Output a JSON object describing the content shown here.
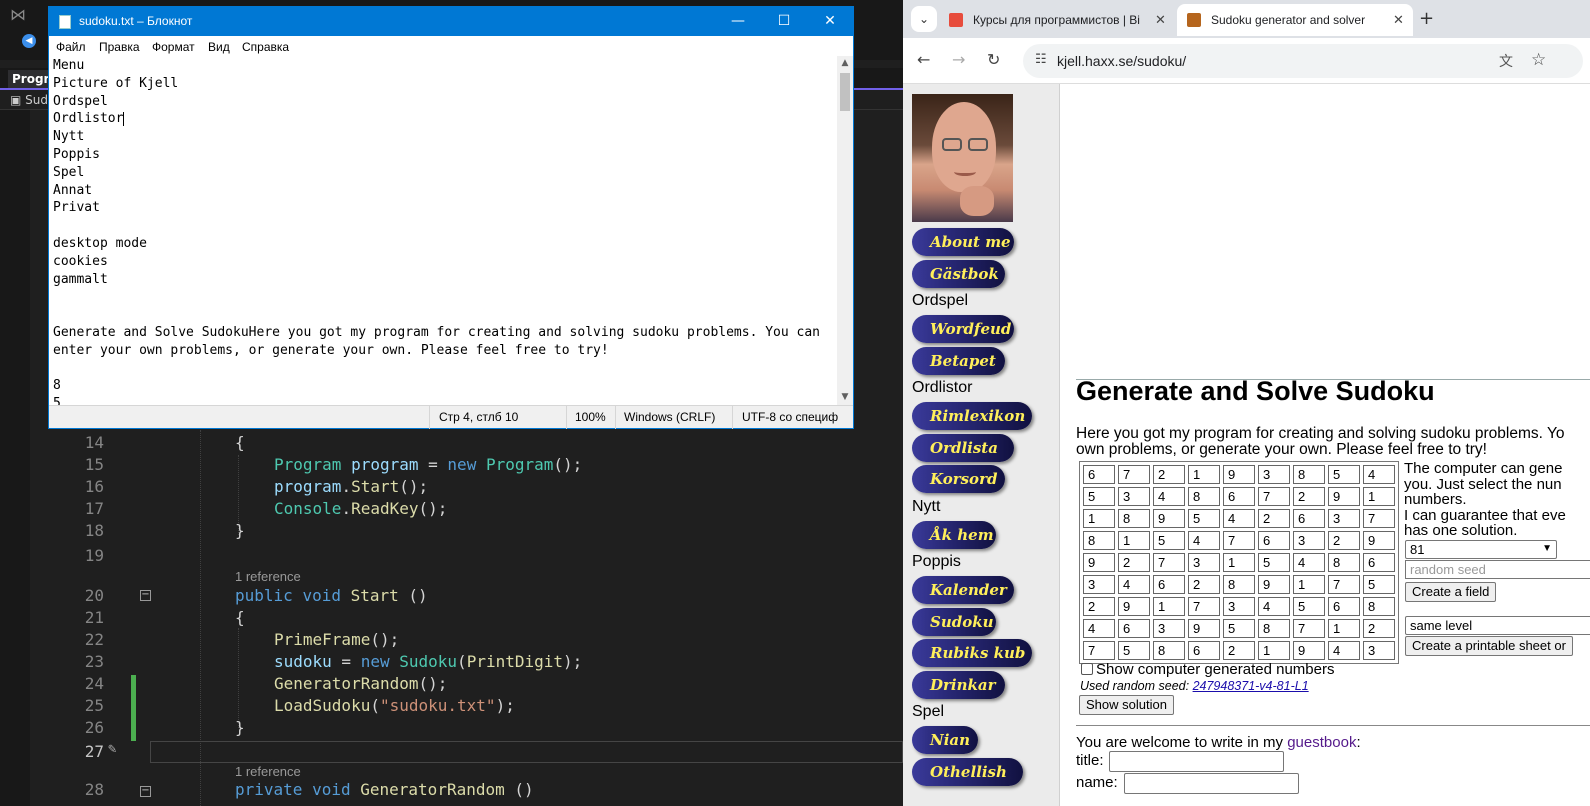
{
  "notepad": {
    "title": "sudoku.txt – Блокнот",
    "menu": [
      "Файл",
      "Правка",
      "Формат",
      "Вид",
      "Справка"
    ],
    "lines": [
      "Menu",
      "Picture of Kjell",
      "Ordspel",
      "Ordlistor",
      "Nytt",
      "Poppis",
      "Spel",
      "Annat",
      "Privat",
      "",
      "desktop mode",
      "cookies",
      "gammalt",
      "",
      "",
      "Generate and Solve SudokuHere you got my program for creating and solving sudoku problems. You can",
      "enter your own problems, or generate your own. Please feel free to try!",
      "",
      "8",
      "5"
    ],
    "status": {
      "position": "Стр 4, стлб 10",
      "zoom": "100%",
      "line_ending": "Windows (CRLF)",
      "encoding": "UTF-8 со специф"
    }
  },
  "vs": {
    "tab_label": "Progra",
    "file_label": "Sud",
    "codelens": "1 reference",
    "lines": [
      {
        "num": "14",
        "code": "{"
      },
      {
        "num": "15",
        "code": "Program program = new Program();"
      },
      {
        "num": "16",
        "code": "program.Start();"
      },
      {
        "num": "17",
        "code": "Console.ReadKey();"
      },
      {
        "num": "18",
        "code": "}"
      },
      {
        "num": "19",
        "code": ""
      },
      {
        "num": "20",
        "code": "public void Start ()"
      },
      {
        "num": "21",
        "code": "{"
      },
      {
        "num": "22",
        "code": "PrimeFrame();"
      },
      {
        "num": "23",
        "code": "sudoku = new Sudoku(PrintDigit);"
      },
      {
        "num": "24",
        "code": "GeneratorRandom();"
      },
      {
        "num": "25",
        "code": "LoadSudoku(\"sudoku.txt\");"
      },
      {
        "num": "26",
        "code": "}"
      },
      {
        "num": "27",
        "code": ""
      },
      {
        "num": "28",
        "code": "private void GeneratorRandom ()"
      }
    ]
  },
  "chrome": {
    "tabs": [
      {
        "label": "Курсы для программистов | Ві",
        "active": false
      },
      {
        "label": "Sudoku generator and solver",
        "active": true
      }
    ],
    "url": "kjell.haxx.se/sudoku/"
  },
  "page": {
    "sidebar": [
      {
        "type": "button",
        "label": "About me"
      },
      {
        "type": "button",
        "label": "Gästbok"
      },
      {
        "type": "heading",
        "label": "Ordspel"
      },
      {
        "type": "button",
        "label": "Wordfeud"
      },
      {
        "type": "button",
        "label": "Betapet"
      },
      {
        "type": "heading",
        "label": "Ordlistor"
      },
      {
        "type": "button",
        "label": "Rimlexikon"
      },
      {
        "type": "button",
        "label": "Ordlista"
      },
      {
        "type": "button",
        "label": "Korsord"
      },
      {
        "type": "heading",
        "label": "Nytt"
      },
      {
        "type": "button",
        "label": "Åk hem"
      },
      {
        "type": "heading",
        "label": "Poppis"
      },
      {
        "type": "button",
        "label": "Kalender"
      },
      {
        "type": "button",
        "label": "Sudoku"
      },
      {
        "type": "button",
        "label": "Rubiks kub"
      },
      {
        "type": "button",
        "label": "Drinkar"
      },
      {
        "type": "heading",
        "label": "Spel"
      },
      {
        "type": "button",
        "label": "Nian"
      },
      {
        "type": "button",
        "label": "Othellish"
      }
    ],
    "heading": "Generate and Solve Sudoku",
    "intro_line1": "Here you got my program for creating and solving sudoku problems. Yo",
    "intro_line2": "own problems, or generate your own. Please feel free to try!",
    "grid": [
      [
        "6",
        "7",
        "2",
        "1",
        "9",
        "3",
        "8",
        "5",
        "4"
      ],
      [
        "5",
        "3",
        "4",
        "8",
        "6",
        "7",
        "2",
        "9",
        "1"
      ],
      [
        "1",
        "8",
        "9",
        "5",
        "4",
        "2",
        "6",
        "3",
        "7"
      ],
      [
        "8",
        "1",
        "5",
        "4",
        "7",
        "6",
        "3",
        "2",
        "9"
      ],
      [
        "9",
        "2",
        "7",
        "3",
        "1",
        "5",
        "4",
        "8",
        "6"
      ],
      [
        "3",
        "4",
        "6",
        "2",
        "8",
        "9",
        "1",
        "7",
        "5"
      ],
      [
        "2",
        "9",
        "1",
        "7",
        "3",
        "4",
        "5",
        "6",
        "8"
      ],
      [
        "4",
        "6",
        "3",
        "9",
        "5",
        "8",
        "7",
        "1",
        "2"
      ],
      [
        "7",
        "5",
        "8",
        "6",
        "2",
        "1",
        "9",
        "4",
        "3"
      ]
    ],
    "side_text": [
      "The computer can gene",
      "you. Just select the nun",
      "numbers.",
      "I can guarantee that eve",
      "has one solution."
    ],
    "count_select": "81",
    "seed_placeholder": "random seed",
    "create_field_button": "Create a field",
    "level_select": "same level",
    "printable_button": "Create a printable sheet or",
    "show_generated_label": "Show computer generated numbers",
    "used_seed_label": "Used random seed:",
    "used_seed_value": "247948371-v4-81-L1",
    "show_solution_button": "Show solution",
    "guestbook_prefix": "You are welcome to write in my",
    "guestbook_link": "guestbook",
    "guestbook_suffix": ":",
    "title_label": "title:",
    "name_label": "name:"
  }
}
